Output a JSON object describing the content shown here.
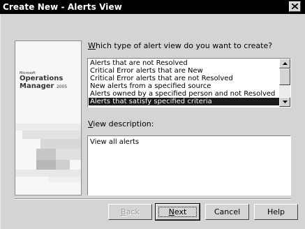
{
  "window": {
    "title": "Create New - Alerts View",
    "close_icon": "close-icon"
  },
  "sidebar": {
    "brand_company": "Microsoft",
    "brand_product_line1": "Operations",
    "brand_product_line2": "Manager",
    "brand_year": "2005"
  },
  "question": {
    "prefix": "W",
    "rest": "hich type of alert view do you want to create?"
  },
  "alert_types": [
    {
      "label": "Alerts that are not Resolved",
      "selected": false
    },
    {
      "label": "Critical Error alerts that are New",
      "selected": false
    },
    {
      "label": "Critical Error alerts that are not Resolved",
      "selected": false
    },
    {
      "label": "New alerts from a specified source",
      "selected": false
    },
    {
      "label": "Alerts owned by a specified person and not Resolved",
      "selected": false
    },
    {
      "label": "Alerts that satisfy specified criteria",
      "selected": true
    }
  ],
  "description": {
    "label_prefix": "V",
    "label_rest": "iew description:",
    "text": "View all alerts"
  },
  "buttons": {
    "back_prefix": "B",
    "back_rest": "ack",
    "next_prefix": "N",
    "next_rest": "ext",
    "cancel": "Cancel",
    "help": "Help"
  }
}
